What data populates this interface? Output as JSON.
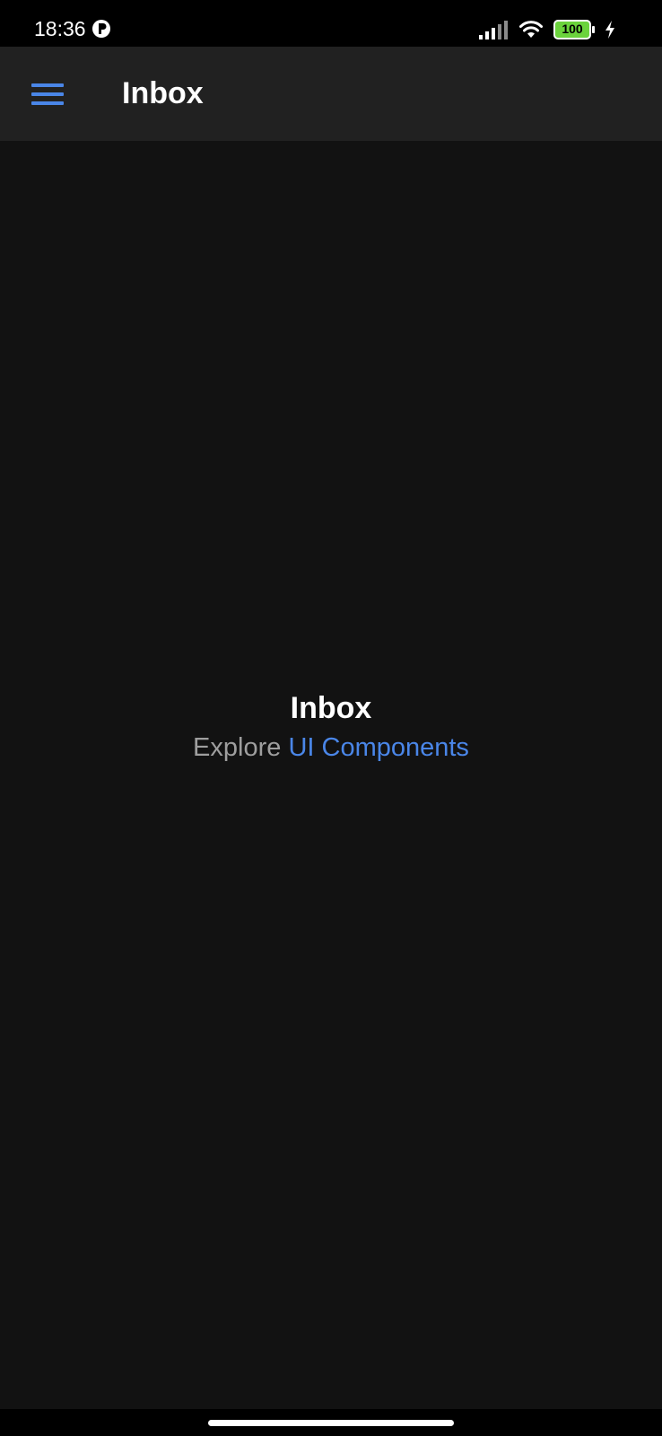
{
  "status_bar": {
    "time": "18:36",
    "battery_level": "100",
    "icons": [
      "app-notification-icon",
      "signal-icon",
      "wifi-icon",
      "battery-icon",
      "charging-icon"
    ]
  },
  "app_bar": {
    "title": "Inbox",
    "menu_icon": "hamburger-menu-icon"
  },
  "content": {
    "title": "Inbox",
    "subtitle_prefix": "Explore",
    "subtitle_link": "UI Components"
  },
  "colors": {
    "background": "#121212",
    "app_bar": "#212121",
    "accent": "#4a86e8",
    "muted_text": "#9e9e9e",
    "battery_green": "#6bd33c"
  }
}
